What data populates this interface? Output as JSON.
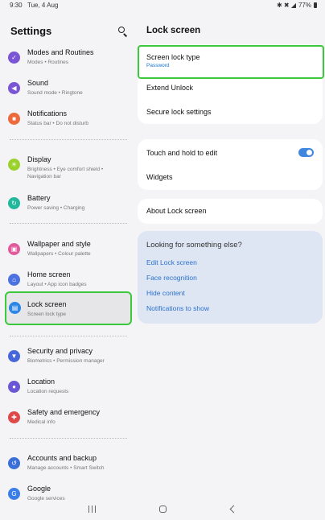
{
  "status_bar": {
    "time": "9:30",
    "date": "Tue, 4 Aug",
    "icons": "✱ ✖ ◢",
    "battery": "77%"
  },
  "left_panel": {
    "title": "Settings",
    "items": [
      {
        "label": "Modes and Routines",
        "sub": "Modes • Routines",
        "icon": "modes-icon",
        "color": "#7a55d6",
        "glyph": "✓"
      },
      {
        "label": "Sound",
        "sub": "Sound mode • Ringtone",
        "icon": "sound-icon",
        "color": "#7a55d6",
        "glyph": "◀"
      },
      {
        "label": "Notifications",
        "sub": "Status bar • Do not disturb",
        "icon": "notifications-icon",
        "color": "#ec6a3c",
        "glyph": "■"
      },
      {
        "label": "Display",
        "sub": "Brightness • Eye comfort shield •",
        "sub2": "Navigation bar",
        "icon": "display-icon",
        "color": "#9ad12b",
        "glyph": "☀"
      },
      {
        "label": "Battery",
        "sub": "Power saving • Charging",
        "icon": "battery-icon",
        "color": "#21b89b",
        "glyph": "↻"
      },
      {
        "label": "Wallpaper and style",
        "sub": "Wallpapers • Colour palette",
        "icon": "wallpaper-icon",
        "color": "#e15a9c",
        "glyph": "▣"
      },
      {
        "label": "Home screen",
        "sub": "Layout • App icon badges",
        "icon": "home-screen-icon",
        "color": "#4b72e0",
        "glyph": "⌂"
      },
      {
        "label": "Lock screen",
        "sub": "Screen lock type",
        "icon": "lock-icon",
        "color": "#2b86e6",
        "glyph": "▤"
      },
      {
        "label": "Security and privacy",
        "sub": "Biometrics • Permission manager",
        "icon": "shield-icon",
        "color": "#4766d9",
        "glyph": "▼"
      },
      {
        "label": "Location",
        "sub": "Location requests",
        "icon": "location-icon",
        "color": "#6a57d5",
        "glyph": "●"
      },
      {
        "label": "Safety and emergency",
        "sub": "Medical info",
        "icon": "emergency-icon",
        "color": "#e04848",
        "glyph": "✚"
      },
      {
        "label": "Accounts and backup",
        "sub": "Manage accounts • Smart Switch",
        "icon": "accounts-icon",
        "color": "#3a6fd8",
        "glyph": "↺"
      },
      {
        "label": "Google",
        "sub": "Google services",
        "icon": "google-icon",
        "color": "#3b7ee8",
        "glyph": "G"
      }
    ]
  },
  "right_panel": {
    "title": "Lock screen",
    "screen_lock_type": {
      "label": "Screen lock type",
      "value": "Password"
    },
    "extend_unlock": "Extend Unlock",
    "secure_lock_settings": "Secure lock settings",
    "touch_and_hold": {
      "label": "Touch and hold to edit",
      "enabled": true
    },
    "widgets": "Widgets",
    "about": "About Lock screen",
    "suggestions": {
      "title": "Looking for something else?",
      "links": [
        "Edit Lock screen",
        "Face recognition",
        "Hide content",
        "Notifications to show"
      ]
    }
  },
  "colors": {
    "highlight": "#3cc83c",
    "accent": "#2a72cc",
    "toggle": "#3e86e0"
  }
}
